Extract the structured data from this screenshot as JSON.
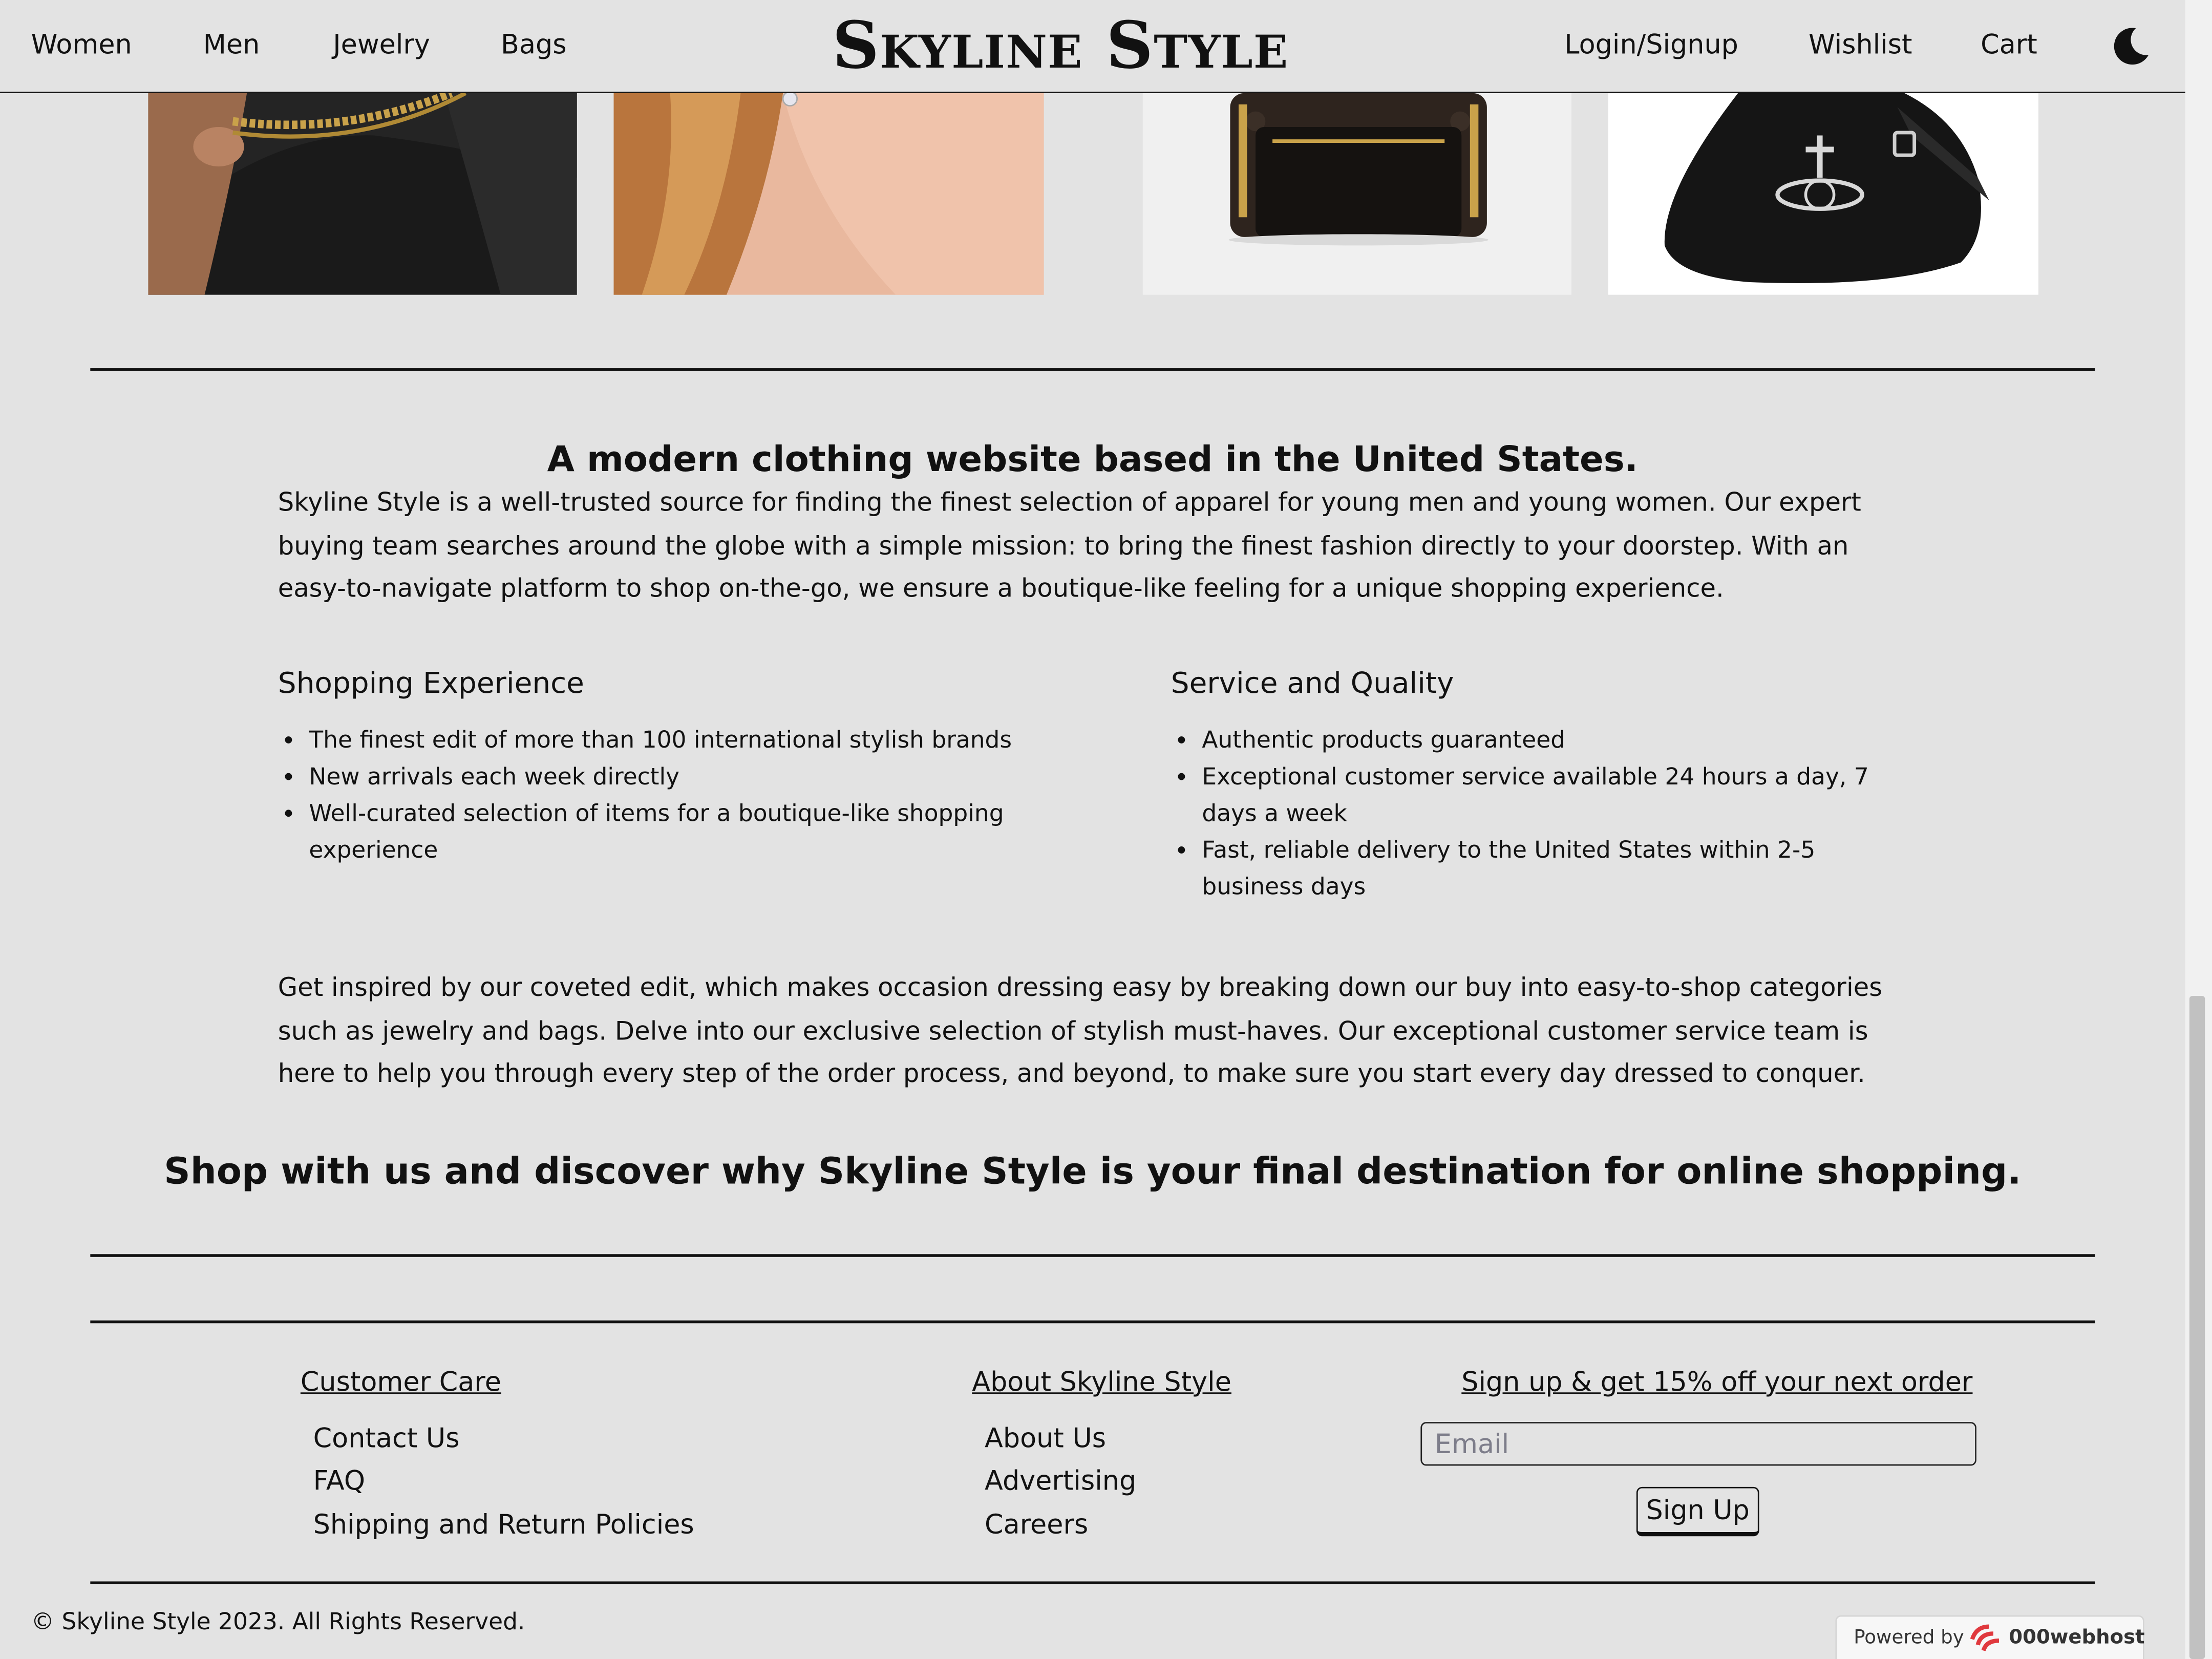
{
  "nav": {
    "left": [
      "Women",
      "Men",
      "Jewelry",
      "Bags"
    ],
    "brand": "Skyline Style",
    "right": [
      "Login/Signup",
      "Wishlist",
      "Cart"
    ],
    "theme_toggle_icon": "moon-icon"
  },
  "products": [
    {
      "name": "gold-chain-necklace-image"
    },
    {
      "name": "earring-model-image"
    },
    {
      "name": "dark-monogram-backpack-image"
    },
    {
      "name": "black-handbag-orb-logo-image"
    }
  ],
  "about": {
    "heading": "A modern clothing website based in the United States.",
    "intro": "Skyline Style is a well-trusted source for finding the finest selection of apparel for young men and young women. Our expert buying team searches around the globe with a simple mission: to bring the finest fashion directly to your doorstep. With an easy-to-navigate platform to shop on-the-go, we ensure a boutique-like feeling for a unique shopping experience.",
    "columns": [
      {
        "title": "Shopping Experience",
        "items": [
          "The finest edit of more than 100 international stylish brands",
          "New arrivals each week directly",
          "Well-curated selection of items for a boutique-like shopping experience"
        ]
      },
      {
        "title": "Service and Quality",
        "items": [
          "Authentic products guaranteed",
          "Exceptional customer service available 24 hours a day, 7 days a week",
          "Fast, reliable delivery to the United States within 2-5 business days"
        ]
      }
    ],
    "outro": "Get inspired by our coveted edit, which makes occasion dressing easy by breaking down our buy into easy-to-shop categories such as jewelry and bags. Delve into our exclusive selection of stylish must-haves. Our exceptional customer service team is here to help you through every step of the order process, and beyond, to make sure you start every day dressed to conquer.",
    "tagline": "Shop with us and discover why Skyline Style is your final destination for online shopping."
  },
  "footer": {
    "customer_care": {
      "title": "Customer Care",
      "links": [
        "Contact Us",
        "FAQ",
        "Shipping and Return Policies"
      ]
    },
    "about": {
      "title": "About Skyline Style",
      "links": [
        "About Us",
        "Advertising",
        "Careers"
      ]
    },
    "signup": {
      "title": "Sign up & get 15% off your next order",
      "email_placeholder": "Email",
      "button": "Sign Up"
    },
    "copyright": "© Skyline Style 2023. All Rights Reserved.",
    "powered_by": "Powered by",
    "host": "000webhost"
  },
  "colors": {
    "background": "#e3e3e3",
    "text": "#111111",
    "host_logo": "#e0393e"
  }
}
